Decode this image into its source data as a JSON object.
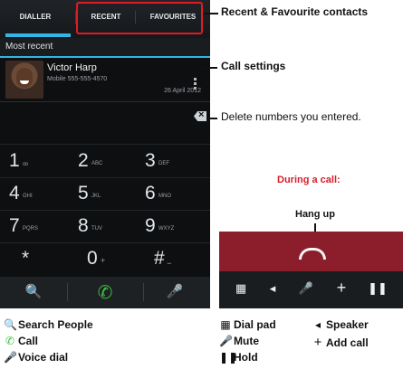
{
  "phone": {
    "tabs": [
      "DIALLER",
      "RECENT",
      "FAVOURITES"
    ],
    "section_label": "Most recent",
    "contact": {
      "name": "Victor Harp",
      "number": "Mobile 555-555-4570",
      "date": "26 April 2012"
    },
    "keys": [
      {
        "digit": "1",
        "sub": "ꝏ"
      },
      {
        "digit": "2",
        "sub": "ABC"
      },
      {
        "digit": "3",
        "sub": "DEF"
      },
      {
        "digit": "4",
        "sub": "GHI"
      },
      {
        "digit": "5",
        "sub": "JKL"
      },
      {
        "digit": "6",
        "sub": "MNO"
      },
      {
        "digit": "7",
        "sub": "PQRS"
      },
      {
        "digit": "8",
        "sub": "TUV"
      },
      {
        "digit": "9",
        "sub": "WXYZ"
      },
      {
        "digit": "*",
        "sub": ""
      },
      {
        "digit": "0",
        "sub": "+"
      },
      {
        "digit": "#",
        "sub": "⎵"
      }
    ],
    "callbar": {
      "search": "🔍",
      "call": "✆",
      "voice": "🎤"
    }
  },
  "callouts": {
    "recent_fav": "Recent & Favourite contacts",
    "call_settings": "Call settings",
    "delete_numbers": "Delete numbers you entered.",
    "during_call": "During a call:",
    "hang_up": "Hang up"
  },
  "incall_icons": [
    "▦",
    "◂",
    "🎤",
    "+",
    "❚❚"
  ],
  "legend": {
    "search_people": "Search People",
    "call": "Call",
    "voice_dial": "Voice dial",
    "dial_pad": "Dial pad",
    "mute": "Mute",
    "hold": "Hold",
    "speaker": "Speaker",
    "add_call": "Add call"
  },
  "colors": {
    "accent": "#33b5e5",
    "callout_red": "#d81e29",
    "call_green": "#3fbf3f"
  }
}
